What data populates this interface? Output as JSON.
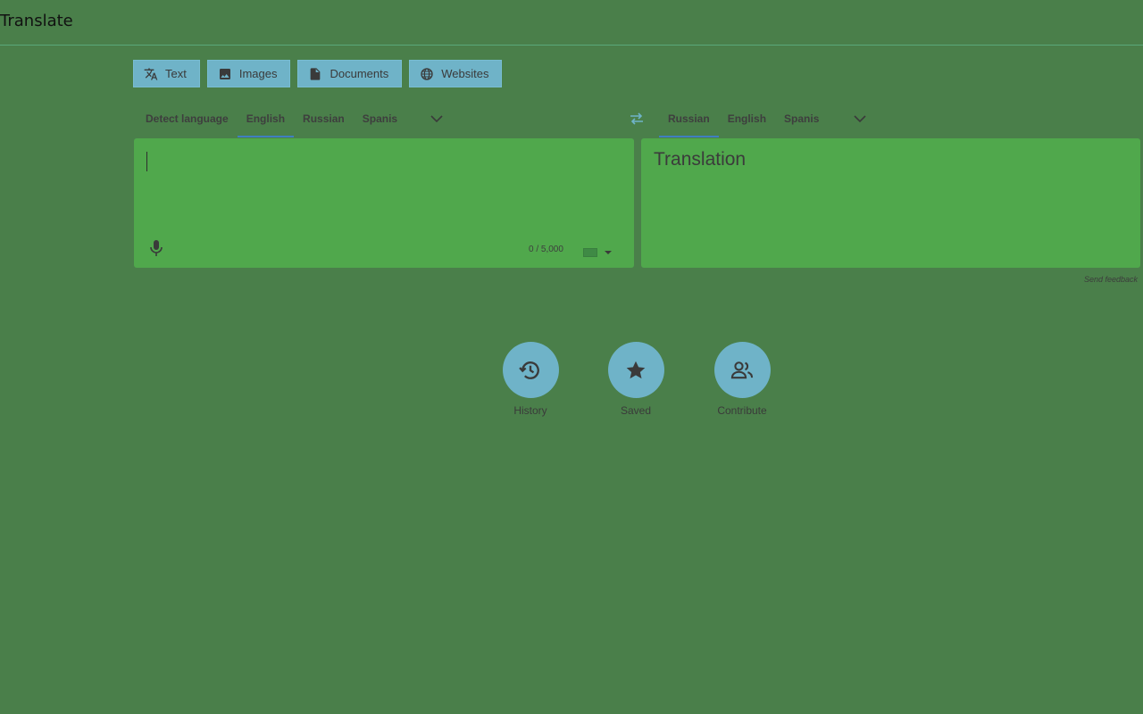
{
  "app": {
    "title": "Translate"
  },
  "mode_tabs": [
    {
      "label": "Text",
      "icon": "translate-icon"
    },
    {
      "label": "Images",
      "icon": "image-icon"
    },
    {
      "label": "Documents",
      "icon": "document-icon"
    },
    {
      "label": "Websites",
      "icon": "globe-icon"
    }
  ],
  "source_langs": {
    "detect": "Detect language",
    "items": [
      "English",
      "Russian",
      "Spanis"
    ],
    "active": "English"
  },
  "target_langs": {
    "items": [
      "Russian",
      "English",
      "Spanis"
    ],
    "active": "Russian"
  },
  "source_panel": {
    "text": "",
    "char_count": "0 / 5,000"
  },
  "target_panel": {
    "placeholder": "Translation"
  },
  "feedback": "Send feedback",
  "actions": [
    {
      "label": "History",
      "icon": "history-icon"
    },
    {
      "label": "Saved",
      "icon": "star-icon"
    },
    {
      "label": "Contribute",
      "icon": "people-icon"
    }
  ],
  "colors": {
    "page_bg": "#4a7f4a",
    "panel_bg": "#50a84c",
    "accent_button": "#6fb3c8",
    "active_underline": "#3f7fc0"
  }
}
